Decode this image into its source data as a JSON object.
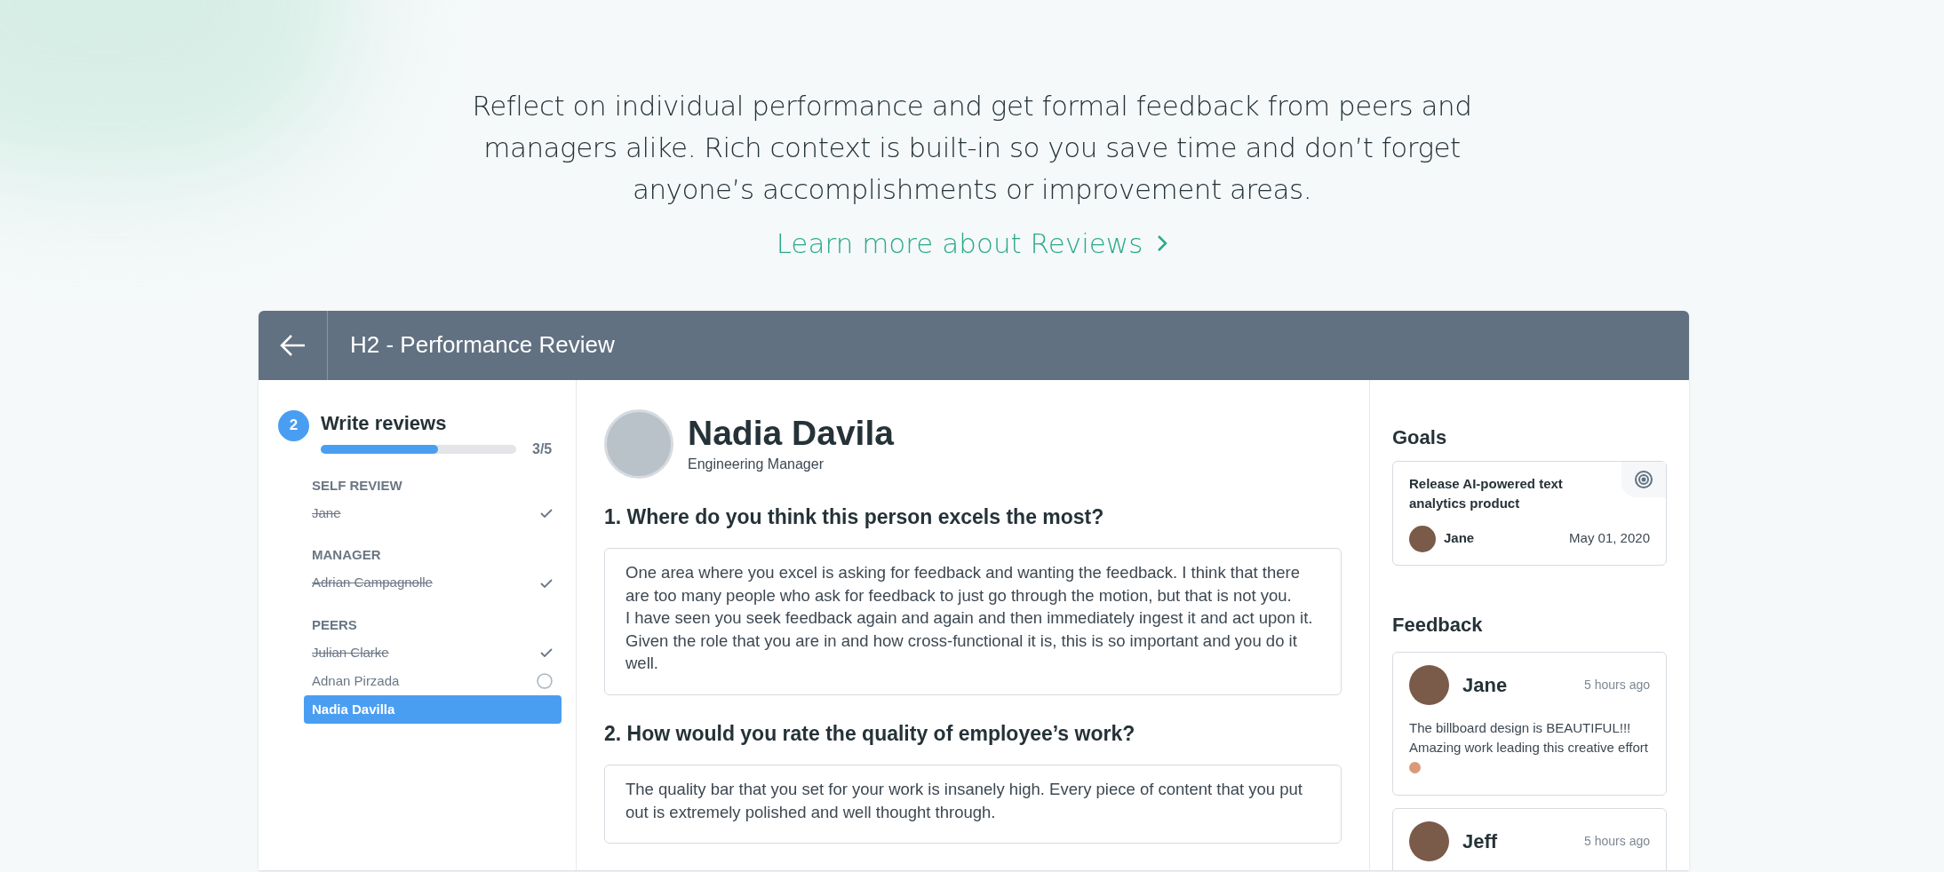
{
  "intro": {
    "text": "Reflect on individual performance and get formal feedback from peers and managers alike. Rich context is built-in so you save time and don’t forget anyone’s accomplishments or improvement areas.",
    "link": "Learn more about Reviews"
  },
  "header": {
    "title": "H2 - Performance Review"
  },
  "step": {
    "number": "2",
    "title": "Write reviews",
    "level": 0.6,
    "count": "3/5"
  },
  "groups": [
    {
      "heading": "SELF REVIEW",
      "reviewees": [
        {
          "name": "Jane",
          "done": true,
          "selected": false
        }
      ]
    },
    {
      "heading": "MANAGER",
      "reviewees": [
        {
          "name": "Adrian Campagnolle",
          "done": true,
          "selected": false
        }
      ]
    },
    {
      "heading": "PEERS",
      "reviewees": [
        {
          "name": "Julian Clarke",
          "done": true,
          "selected": false
        },
        {
          "name": "Adnan Pirzada",
          "done": false,
          "selected": false
        },
        {
          "name": "Nadia Davilla",
          "done": false,
          "selected": true
        }
      ]
    }
  ],
  "reviewee": {
    "name": "Nadia Davila",
    "role": "Engineering Manager"
  },
  "questions": [
    {
      "question": "1. Where do you think this person excels the most?",
      "answer": "One area where you excel is asking for feedback and wanting the feedback. I think that there are too many people who ask for feedback to just go through the motion, but that is not you.\nI have seen you seek feedback again and again and then immediately ingest it and act upon it. Given the role that you are in and how cross-functional it is, this is so important and you do it well."
    },
    {
      "question": "2. How would you rate the quality of employee’s work?",
      "answer": "The quality bar that you set for your work is insanely high. Every piece of content that you put out is extremely polished and well thought through."
    }
  ],
  "goals": {
    "heading": "Goals",
    "items": [
      {
        "title": "Release AI-powered text analytics product",
        "owner": "Jane",
        "date": "May 01, 2020"
      }
    ]
  },
  "feedback": {
    "heading": "Feedback",
    "items": [
      {
        "author": "Jane",
        "time": "5 hours ago",
        "message": "The billboard design is BEAUTIFUL!!! Amazing work leading this creative effort"
      },
      {
        "author": "Jeff",
        "time": "5 hours ago"
      }
    ]
  }
}
